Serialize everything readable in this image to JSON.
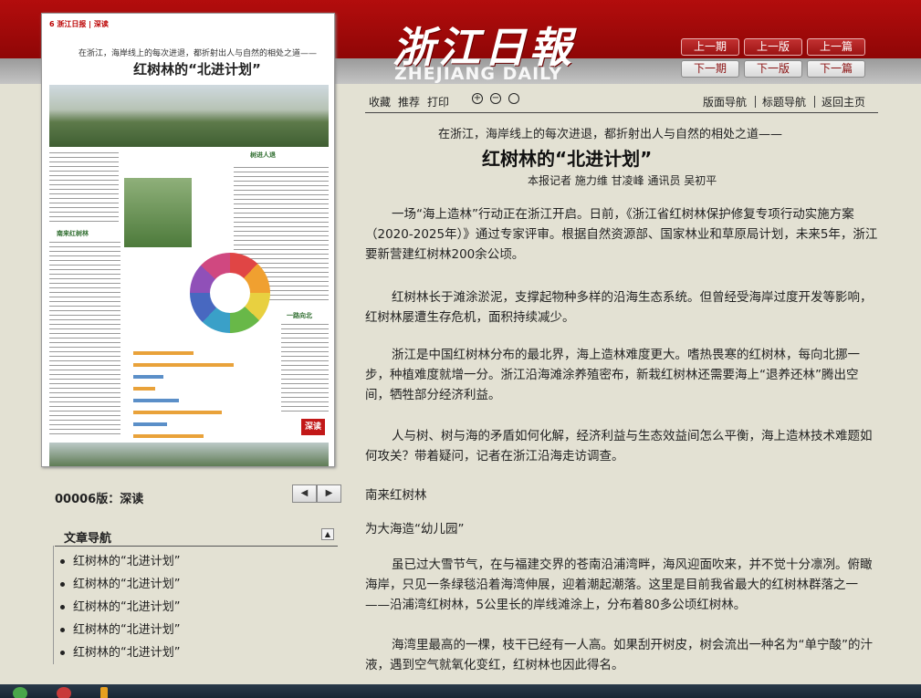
{
  "header": {
    "logo_cn": "浙江日報",
    "logo_en": "ZHEJIANG DAILY",
    "nav_buttons": [
      {
        "label": "上一期"
      },
      {
        "label": "上一版"
      },
      {
        "label": "上一篇"
      },
      {
        "label": "下一期"
      },
      {
        "label": "下一版"
      },
      {
        "label": "下一篇"
      }
    ]
  },
  "thumbnail": {
    "head": "6 浙江日报 | 深读",
    "subtitle": "在浙江，海岸线上的每次进退，都折射出人与自然的相处之道——",
    "title": "红树林的“北进计划”",
    "tag1": "树进人退",
    "tag2": "南来红树林",
    "tag3": "一路向北",
    "badge": "深读"
  },
  "edition": {
    "label": "00006版：深读",
    "prev_icon": "left-arrow-icon",
    "next_icon": "right-arrow-icon"
  },
  "article_nav": {
    "title": "文章导航",
    "items": [
      "红树林的“北进计划”",
      "红树林的“北进计划”",
      "红树林的“北进计划”",
      "红树林的“北进计划”",
      "红树林的“北进计划”"
    ]
  },
  "toolbar": {
    "collect": "收藏",
    "recommend": "推荐",
    "print": "打印",
    "zoom_in": "+",
    "zoom_out": "−",
    "zoom_reset": "○",
    "page_nav": "版面导航",
    "title_nav": "标题导航",
    "home": "返回主页"
  },
  "article": {
    "kicker": "在浙江，海岸线上的每次进退，都折射出人与自然的相处之道——",
    "title": "红树林的“北进计划”",
    "byline": "本报记者 施力维 甘凌峰 通讯员 吴初平",
    "paragraphs": [
      "一场“海上造林”行动正在浙江开启。日前，《浙江省红树林保护修复专项行动实施方案（2020-2025年）》通过专家评审。根据自然资源部、国家林业和草原局计划，未来5年，浙江要新营建红树林200余公顷。",
      "红树林长于滩涂淤泥，支撑起物种多样的沿海生态系统。但曾经受海岸过度开发等影响，红树林屡遭生存危机，面积持续减少。",
      "浙江是中国红树林分布的最北界，海上造林难度更大。嗜热畏寒的红树林，每向北挪一步，种植难度就增一分。浙江沿海滩涂养殖密布，新栽红树林还需要海上“退养还林”腾出空间，牺牲部分经济利益。",
      "人与树、树与海的矛盾如何化解，经济利益与生态效益间怎么平衡，海上造林技术难题如何攻关？带着疑问，记者在浙江沿海走访调查。",
      "南来红树林",
      "为大海造“幼儿园”",
      "虽已过大雪节气，在与福建交界的苍南沿浦湾畔，海风迎面吹来，并不觉十分凛冽。俯瞰海岸，只见一条绿毯沿着海湾伸展，迎着潮起潮落。这里是目前我省最大的红树林群落之一——沿浦湾红树林，5公里长的岸线滩涂上，分布着80多公顷红树林。",
      "海湾里最高的一棵，枝干已经有一人高。如果刮开树皮，树会流出一种名为“单宁酸”的汁液，遇到空气就氧化变红，红树林也因此得名。"
    ]
  }
}
